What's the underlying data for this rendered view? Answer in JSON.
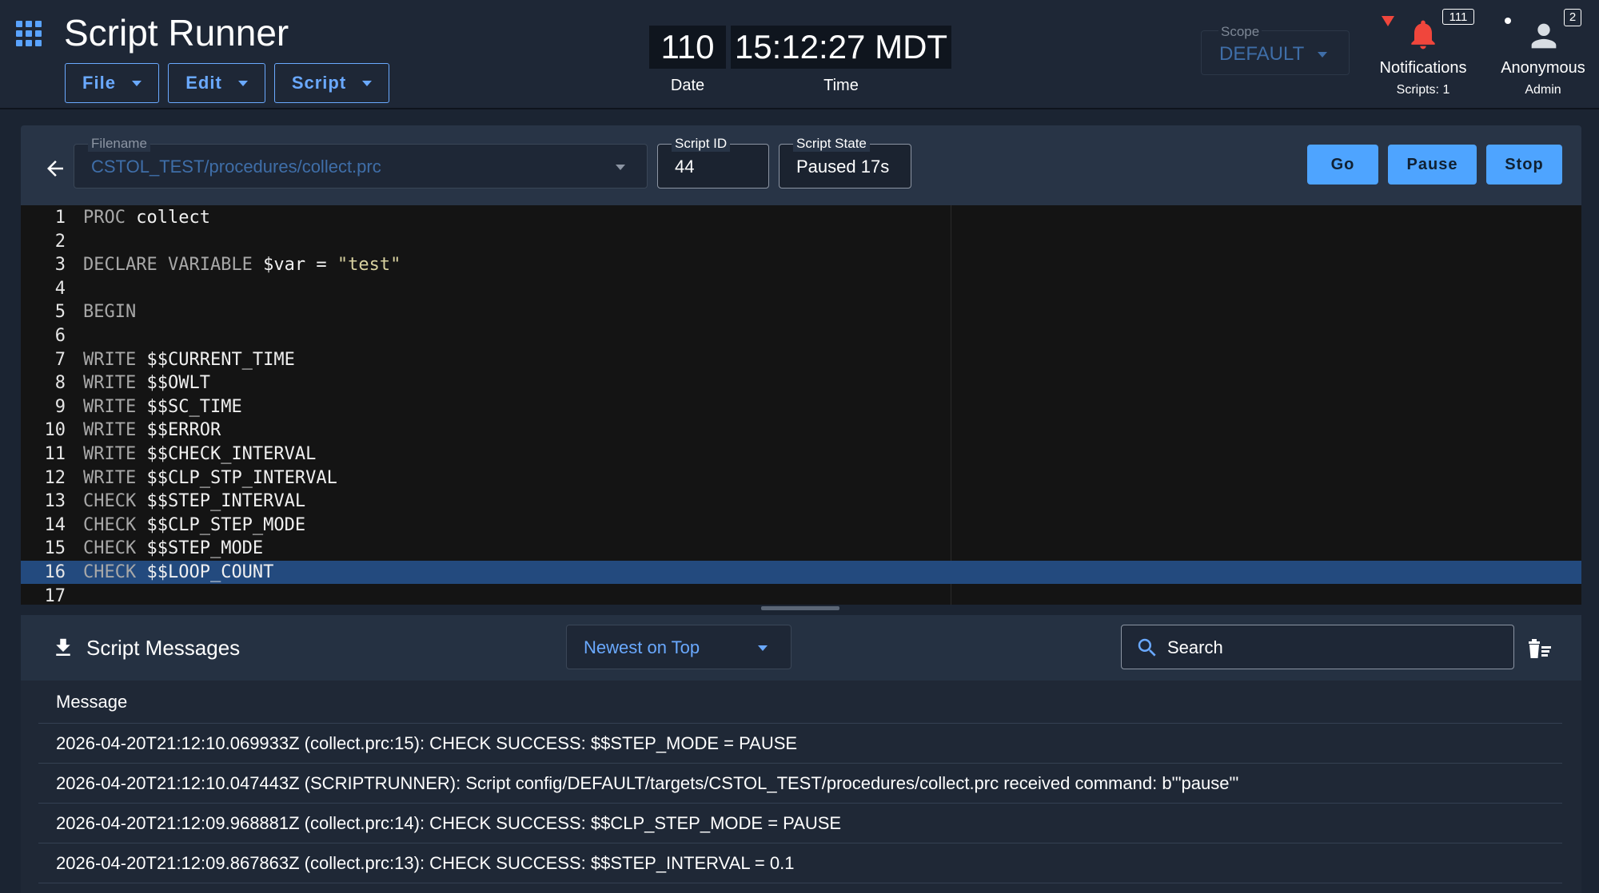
{
  "app": {
    "title": "Script Runner",
    "menus": [
      {
        "label": "File"
      },
      {
        "label": "Edit"
      },
      {
        "label": "Script"
      }
    ]
  },
  "clock": {
    "date_value": "110",
    "time_value": "15:12:27 MDT",
    "date_label": "Date",
    "time_label": "Time"
  },
  "scope": {
    "label": "Scope",
    "value": "DEFAULT"
  },
  "notifications": {
    "count": "111",
    "label": "Notifications",
    "sub": "Scripts: 1"
  },
  "user": {
    "count": "2",
    "name": "Anonymous",
    "role": "Admin"
  },
  "toolbar": {
    "filename_label": "Filename",
    "filename_value": "CSTOL_TEST/procedures/collect.prc",
    "script_id_label": "Script ID",
    "script_id_value": "44",
    "script_state_label": "Script State",
    "script_state_value": "Paused 17s",
    "go_label": "Go",
    "pause_label": "Pause",
    "stop_label": "Stop"
  },
  "editor": {
    "active_line": 16,
    "lines": [
      {
        "n": "1",
        "kw": "PROC",
        "rest": " collect"
      },
      {
        "n": "2",
        "kw": "",
        "rest": ""
      },
      {
        "n": "3",
        "kw": "DECLARE VARIABLE",
        "rest": " $var = ",
        "str": "\"test\""
      },
      {
        "n": "4",
        "kw": "",
        "rest": ""
      },
      {
        "n": "5",
        "kw": "BEGIN",
        "rest": ""
      },
      {
        "n": "6",
        "kw": "",
        "rest": ""
      },
      {
        "n": "7",
        "kw": "WRITE",
        "rest": " $$CURRENT_TIME"
      },
      {
        "n": "8",
        "kw": "WRITE",
        "rest": " $$OWLT"
      },
      {
        "n": "9",
        "kw": "WRITE",
        "rest": " $$SC_TIME"
      },
      {
        "n": "10",
        "kw": "WRITE",
        "rest": " $$ERROR"
      },
      {
        "n": "11",
        "kw": "WRITE",
        "rest": " $$CHECK_INTERVAL"
      },
      {
        "n": "12",
        "kw": "WRITE",
        "rest": " $$CLP_STP_INTERVAL"
      },
      {
        "n": "13",
        "kw": "CHECK",
        "rest": " $$STEP_INTERVAL"
      },
      {
        "n": "14",
        "kw": "CHECK",
        "rest": " $$CLP_STEP_MODE"
      },
      {
        "n": "15",
        "kw": "CHECK",
        "rest": " $$STEP_MODE"
      },
      {
        "n": "16",
        "kw": "CHECK",
        "rest": " $$LOOP_COUNT"
      },
      {
        "n": "17",
        "kw": "",
        "rest": ""
      }
    ]
  },
  "messages": {
    "title": "Script Messages",
    "sort_value": "Newest on Top",
    "search_placeholder": "Search",
    "column_header": "Message",
    "rows": [
      "2026-04-20T21:12:10.069933Z (collect.prc:15): CHECK SUCCESS: $$STEP_MODE = PAUSE",
      "2026-04-20T21:12:10.047443Z (SCRIPTRUNNER): Script config/DEFAULT/targets/CSTOL_TEST/procedures/collect.prc received command: b'\"pause\"'",
      "2026-04-20T21:12:09.968881Z (collect.prc:14): CHECK SUCCESS: $$CLP_STEP_MODE = PAUSE",
      "2026-04-20T21:12:09.867863Z (collect.prc:13): CHECK SUCCESS: $$STEP_INTERVAL = 0.1"
    ]
  },
  "colors": {
    "accent": "#4ea4ff",
    "background": "#1b2432",
    "appbar": "#1e2736",
    "editor_bg": "#141414",
    "active_line": "#234a7e",
    "alert": "#f0463c"
  },
  "icons": [
    "apps-grid-icon",
    "caret-down-icon",
    "alert-triangle-icon",
    "bell-icon",
    "person-icon",
    "arrow-left-icon",
    "download-icon",
    "search-icon",
    "clear-list-icon"
  ]
}
